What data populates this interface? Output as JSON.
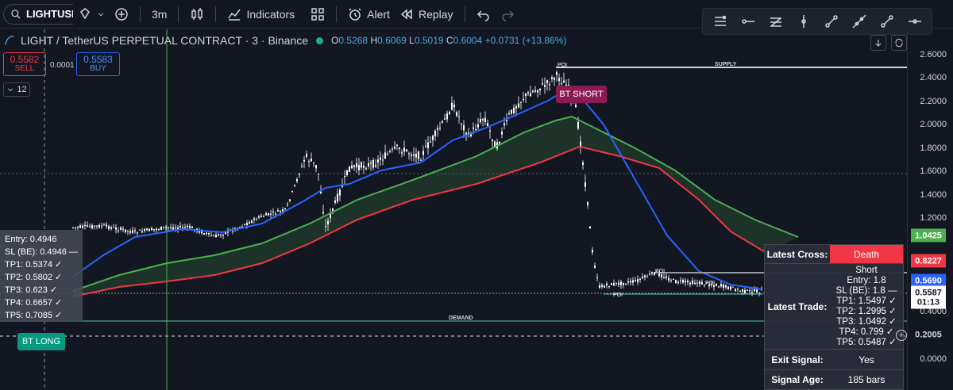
{
  "toolbar": {
    "symbol": "LIGHTUSDT",
    "interval": "3m",
    "indicators_label": "Indicators",
    "alert_label": "Alert",
    "replay_label": "Replay"
  },
  "legend": {
    "title": "LIGHT / TetherUS PERPETUAL CONTRACT · 3 · Binance",
    "o_label": "O",
    "o": "0.5268",
    "h_label": "H",
    "h": "0.6069",
    "l_label": "L",
    "l": "0.5019",
    "c_label": "C",
    "c": "0.6004",
    "change": "+0.0731 (+13.86%)"
  },
  "trade": {
    "sell_price": "0.5582",
    "sell_label": "SELL",
    "buy_price": "0.5583",
    "buy_label": "BUY",
    "spread": "0.0001",
    "collapse_count": "12"
  },
  "long_panel": [
    "Entry: 0.4946",
    "SL (BE): 0.4946 —",
    "TP1: 0.5374 ✓",
    "TP2: 0.5802 ✓",
    "TP3: 0.623 ✓",
    "TP4: 0.6657 ✓",
    "TP5: 0.7085 ✓"
  ],
  "tags": {
    "bt_long": "BT LONG",
    "bt_short": "BT SHORT",
    "supply": "SUPPLY",
    "demand": "DEMAND",
    "poi": "POI"
  },
  "signal_table": {
    "latest_cross_label": "Latest Cross:",
    "latest_cross_value": "Death",
    "latest_trade_label": "Latest Trade:",
    "latest_trade_lines": [
      "Short",
      "Entry: 1.8",
      "SL (BE): 1.8 —",
      "TP1: 1.5497 ✓",
      "TP2: 1.2995 ✓",
      "TP3: 1.0492 ✓",
      "TP4: 0.799 ✓",
      "TP5: 0.5487 ✓"
    ],
    "exit_signal_label": "Exit Signal:",
    "exit_signal_value": "Yes",
    "signal_age_label": "Signal Age:",
    "signal_age_value": "185 bars"
  },
  "price_axis": {
    "ticks": [
      "2.6000",
      "2.4000",
      "2.2000",
      "2.0000",
      "1.8000",
      "1.6000",
      "1.4000",
      "1.2000",
      "0.4000",
      "0.0000"
    ],
    "badges": [
      {
        "label": "1.0425",
        "value": 1.0425,
        "color": "#4caf50"
      },
      {
        "label": "0.8227",
        "value": 0.8227,
        "color": "#f23645"
      },
      {
        "label": "0.5690",
        "value": 0.569,
        "color": "#2962ff"
      },
      {
        "label": "0.5587",
        "value": 0.5587,
        "color": "#d1d4dc"
      },
      {
        "label": "01:13",
        "value": 0.49,
        "color": "#d1d4dc"
      },
      {
        "label": "0.2005",
        "value": 0.2005,
        "color": "#d1d4dc"
      }
    ]
  },
  "colors": {
    "bg": "#131722",
    "up": "#d1d4dc",
    "fast_ma": "#2962ff",
    "green_ma": "#4caf50",
    "red_ma": "#f23645",
    "crosshair": "#4caf50"
  }
}
